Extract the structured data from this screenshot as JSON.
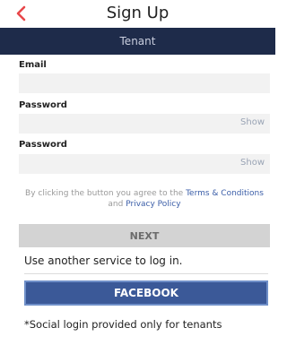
{
  "header": {
    "title": "Sign Up",
    "back_icon": "chevron-left-icon",
    "back_color": "#e8474a"
  },
  "tabbar": {
    "role": "Tenant",
    "background": "#1e2b4a"
  },
  "form": {
    "email_label": "Email",
    "email_value": "",
    "password_label": "Password",
    "password_value": "",
    "password_show": "Show",
    "confirm_label": "Password",
    "confirm_value": "",
    "confirm_show": "Show"
  },
  "terms": {
    "prefix": "By clicking the button you agree to the ",
    "terms_link": "Terms & Conditions",
    "and": " and ",
    "privacy_link": "Privacy Policy"
  },
  "actions": {
    "next_label": "NEXT",
    "service_text": "Use another service to log in.",
    "facebook_label": "FACEBOOK",
    "facebook_color": "#3b5998"
  },
  "footer": {
    "note": "*Social login provided only for tenants"
  }
}
